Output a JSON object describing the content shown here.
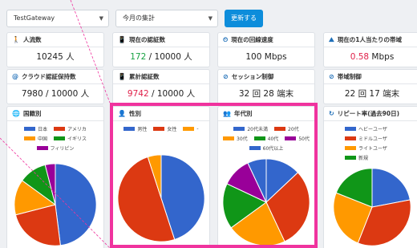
{
  "filters": {
    "gateway": "TestGateway",
    "period": "今月の集計",
    "update_label": "更新する"
  },
  "metrics": [
    {
      "title": "人流数",
      "value": "10245 人"
    },
    {
      "title": "現在の認証数",
      "value_highlight": "172",
      "value_rest": " / 10000 人"
    },
    {
      "title": "現在の回線速度",
      "value": "100 Mbps"
    },
    {
      "title": "現在の1人当たりの帯域",
      "value_highlight": "0.58",
      "value_rest": " Mbps"
    },
    {
      "title": "クラウド認証保持数",
      "value": "7980 / 10000 人"
    },
    {
      "title": "累計認証数",
      "value_highlight": "9742",
      "value_rest": " / 10000 人"
    },
    {
      "title": "セッション制御",
      "value": "32 回 28 端末"
    },
    {
      "title": "帯域制御",
      "value": "22 回 17 端末"
    }
  ],
  "charts": {
    "country": {
      "title": "国籍別",
      "labels": [
        "日本",
        "アメリカ",
        "中国",
        "イギリス",
        "フィリピン"
      ]
    },
    "gender": {
      "title": "性別",
      "labels": [
        "男性",
        "女性",
        "-"
      ]
    },
    "age": {
      "title": "年代別",
      "labels": [
        "20代未満",
        "20代",
        "30代",
        "40代",
        "50代",
        "60代以上"
      ]
    },
    "repeat": {
      "title": "リピート率(過去90日)",
      "labels": [
        "ヘビーユーザ",
        "ミドルユーザ",
        "ライトユーザ",
        "新規"
      ]
    }
  },
  "colors": {
    "blue": "#3366cc",
    "red": "#dc3912",
    "orange": "#ff9900",
    "green": "#109618",
    "purple": "#990099",
    "accent": "#0d8ddb",
    "highlight": "#f0339e"
  },
  "chart_data": [
    {
      "type": "pie",
      "categories": [
        "日本",
        "アメリカ",
        "中国",
        "イギリス",
        "フィリピン"
      ],
      "values": [
        48,
        23,
        14,
        11,
        4
      ]
    },
    {
      "type": "pie",
      "categories": [
        "男性",
        "女性",
        "-"
      ],
      "values": [
        45,
        50,
        5
      ]
    },
    {
      "type": "pie",
      "categories": [
        "20代未満",
        "20代",
        "30代",
        "40代",
        "50代",
        "60代以上"
      ],
      "values": [
        13,
        30,
        22,
        17,
        11,
        7
      ]
    },
    {
      "type": "pie",
      "categories": [
        "ヘビーユーザ",
        "ミドルユーザ",
        "ライトユーザ",
        "新規"
      ],
      "values": [
        22,
        34,
        25,
        19
      ]
    }
  ]
}
